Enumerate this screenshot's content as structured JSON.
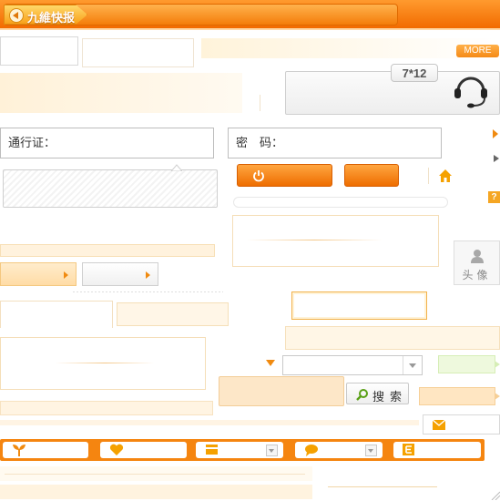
{
  "banner": {
    "title": "九維快报"
  },
  "more_label": "MORE",
  "support": {
    "hours": "7*12"
  },
  "login": {
    "id_label": "通行证：",
    "password_label": "密　码："
  },
  "help_mark": "?",
  "avatar": {
    "label": "头像"
  },
  "search": {
    "button_label": "搜索"
  },
  "colors": {
    "accent": "#f58510",
    "accent_light": "#ffa640",
    "pale": "#fff8ec",
    "border": "#f5deb8"
  },
  "icons": [
    "speaker-icon",
    "headset-icon",
    "power-icon",
    "home-icon",
    "user-icon",
    "search-icon",
    "mail-icon",
    "sprout-icon",
    "heart-icon",
    "card-icon",
    "chat-icon",
    "e-icon"
  ]
}
